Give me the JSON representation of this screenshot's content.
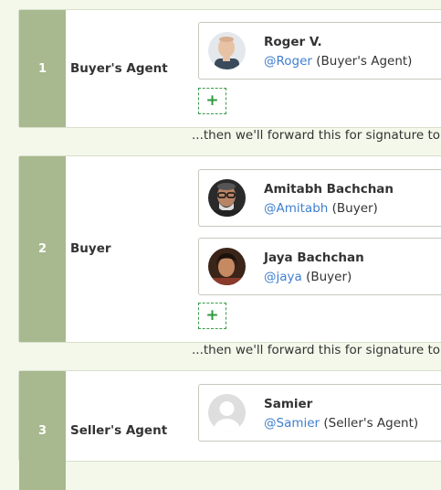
{
  "steps": [
    {
      "number": "1",
      "role": "Buyer's Agent",
      "signers": [
        {
          "name": "Roger V.",
          "handle": "@Roger",
          "role": " (Buyer's Agent)",
          "avatar": "photo-man-bald"
        }
      ],
      "add_label": "+"
    },
    {
      "number": "2",
      "role": "Buyer",
      "signers": [
        {
          "name": "Amitabh Bachchan",
          "handle": "@Amitabh",
          "role": " (Buyer)",
          "avatar": "photo-man-glasses"
        },
        {
          "name": "Jaya Bachchan",
          "handle": "@jaya",
          "role": " (Buyer)",
          "avatar": "photo-woman"
        }
      ],
      "add_label": "+"
    },
    {
      "number": "3",
      "role": "Seller's Agent",
      "signers": [
        {
          "name": "Samier",
          "handle": "@Samier",
          "role": " (Seller's Agent)",
          "avatar": "default-user-silhouette"
        }
      ]
    }
  ],
  "forward_text": "...then we'll forward this for signature to...",
  "colors": {
    "page_bg": "#f3f8ea",
    "step_number_bg": "#a8b88f",
    "link": "#3f7fcf",
    "add_button": "#2f9a3f"
  }
}
